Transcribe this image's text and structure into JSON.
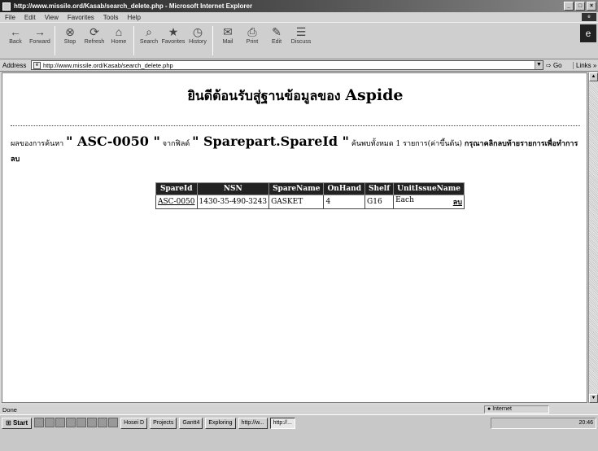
{
  "window": {
    "title": "http://www.missile.ord/Kasab/search_delete.php - Microsoft Internet Explorer",
    "controls": [
      "_",
      "□",
      "×"
    ]
  },
  "menu": {
    "items": [
      "File",
      "Edit",
      "View",
      "Favorites",
      "Tools",
      "Help"
    ]
  },
  "toolbar": {
    "buttons": [
      {
        "label": "Back",
        "icon": "back-arrow-icon",
        "glyph": "←"
      },
      {
        "label": "Forward",
        "icon": "forward-arrow-icon",
        "glyph": "→"
      },
      {
        "label": "Stop",
        "icon": "stop-icon",
        "glyph": "⊗"
      },
      {
        "label": "Refresh",
        "icon": "refresh-icon",
        "glyph": "⟳"
      },
      {
        "label": "Home",
        "icon": "home-icon",
        "glyph": "⌂"
      },
      {
        "label": "Search",
        "icon": "search-icon",
        "glyph": "⌕"
      },
      {
        "label": "Favorites",
        "icon": "favorites-icon",
        "glyph": "★"
      },
      {
        "label": "History",
        "icon": "history-icon",
        "glyph": "◷"
      },
      {
        "label": "Mail",
        "icon": "mail-icon",
        "glyph": "✉"
      },
      {
        "label": "Print",
        "icon": "print-icon",
        "glyph": "⎙"
      },
      {
        "label": "Edit",
        "icon": "edit-icon",
        "glyph": "✎"
      },
      {
        "label": "Discuss",
        "icon": "discuss-icon",
        "glyph": "☰"
      }
    ]
  },
  "address": {
    "label": "Address",
    "url": "http://www.missile.ord/Kasab/search_delete.php",
    "go_label": "Go",
    "links_label": "Links »"
  },
  "page": {
    "heading_prefix": "ยินดีต้อนรับสู่ฐานข้อมูลของ",
    "heading_brand": "Aspide",
    "result": {
      "p1": "ผลของการค้นหา",
      "query": "\" ASC-0050 \"",
      "p2": "จากฟิลด์",
      "field": "\" Sparepart.SpareId \"",
      "p3": "ค้นพบทั้งหมด 1 รายการ(ค่าขึ้นต้น)",
      "instruction": "กรุณาคลิกลบท้ายรายการเพื่อทำการลบ"
    },
    "table": {
      "headers": [
        "SpareId",
        "NSN",
        "SpareName",
        "OnHand",
        "Shelf",
        "UnitIssueName"
      ],
      "rows": [
        {
          "spare_id": "ASC-0050",
          "nsn": "1430-35-490-3243",
          "spare_name": "GASKET",
          "on_hand": "4",
          "shelf": "G16",
          "unit": "Each",
          "action": "ลบ"
        }
      ]
    }
  },
  "status": {
    "text": "Done",
    "zone": "Internet"
  },
  "taskbar": {
    "start_label": "Start",
    "tasks": [
      "Hosei D",
      "Projects",
      "Gantt4",
      "Exploring",
      "http://w...",
      "http://..."
    ],
    "clock": "20:46"
  }
}
